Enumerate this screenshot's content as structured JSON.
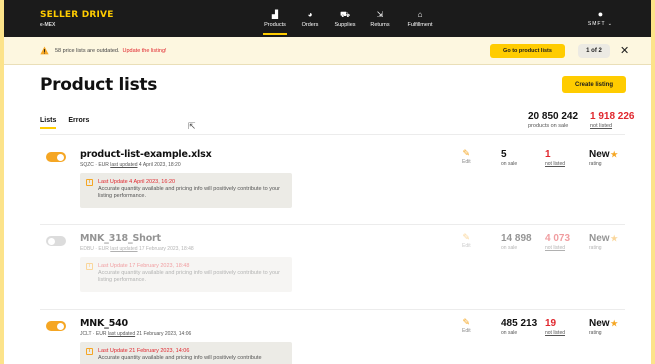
{
  "brand": {
    "name": "SELLER DRIVE",
    "sub": "e-MEX"
  },
  "nav": [
    {
      "label": "Products",
      "icon": "products-icon",
      "glyph": "▟",
      "active": true
    },
    {
      "label": "Orders",
      "icon": "orders-icon",
      "glyph": "◕",
      "active": false
    },
    {
      "label": "Supplies",
      "icon": "supplies-icon",
      "glyph": "⛟",
      "active": false
    },
    {
      "label": "Returns",
      "icon": "returns-icon",
      "glyph": "⇲",
      "active": false
    },
    {
      "label": "Fulfillment",
      "icon": "fulfillment-icon",
      "glyph": "⌂",
      "active": false
    }
  ],
  "account": {
    "label": "SMFT ⌄"
  },
  "notice": {
    "text": "58 price lists are outdated.",
    "link": "Update the listing!",
    "button": "Go to product lists",
    "pager": "1 of 2",
    "close": "✕"
  },
  "page": {
    "title": "Product lists",
    "create": "Create listing"
  },
  "tabs": [
    {
      "label": "Lists",
      "active": true
    },
    {
      "label": "Errors",
      "active": false
    }
  ],
  "totals": {
    "on_sale": {
      "value": "20 850 242",
      "label": "products on sale"
    },
    "not_listed": {
      "value": "1 918 226",
      "label": "not listed"
    }
  },
  "colors": {
    "accent": "#ffcc00",
    "alert": "#e0262d",
    "toggle_on": "#f5a623"
  },
  "rows": [
    {
      "enabled": true,
      "name": "product-list-example.xlsx",
      "meta_prefix": "SQZC · EUR",
      "meta_link": "last updated",
      "meta_date": "4 April 2023, 18:20",
      "info_title": "Last Update 4 April 2023, 16:20",
      "info_body": "Accurate quantity available and pricing info will positively contribute to your listing performance.",
      "edit": "Edit",
      "on_sale": "5",
      "on_sale_label": "on sale",
      "not_listed": "1",
      "not_listed_label": "not listed",
      "rating": "New",
      "rating_label": "rating"
    },
    {
      "enabled": false,
      "name": "MNK_318_Short",
      "meta_prefix": "EDBU · EUR",
      "meta_link": "last updated",
      "meta_date": "17 February 2023, 18:48",
      "info_title": "Last Update 17 February 2023, 18:48",
      "info_body": "Accurate quantity available and pricing info will positively contribute to your listing performance.",
      "edit": "Edit",
      "on_sale": "14 898",
      "on_sale_label": "on sale",
      "not_listed": "4 073",
      "not_listed_label": "not listed",
      "rating": "New",
      "rating_label": "rating"
    },
    {
      "enabled": true,
      "name": "MNK_540",
      "meta_prefix": "JCLT · EUR",
      "meta_link": "last updated",
      "meta_date": "21 February 2023, 14:06",
      "info_title": "Last Update 21 February 2023, 14:06",
      "info_body": "Accurate quantity available and pricing info will positively contribute",
      "edit": "Edit",
      "on_sale": "485 213",
      "on_sale_label": "on sale",
      "not_listed": "19",
      "not_listed_label": "not listed",
      "rating": "New",
      "rating_label": "rating"
    }
  ]
}
